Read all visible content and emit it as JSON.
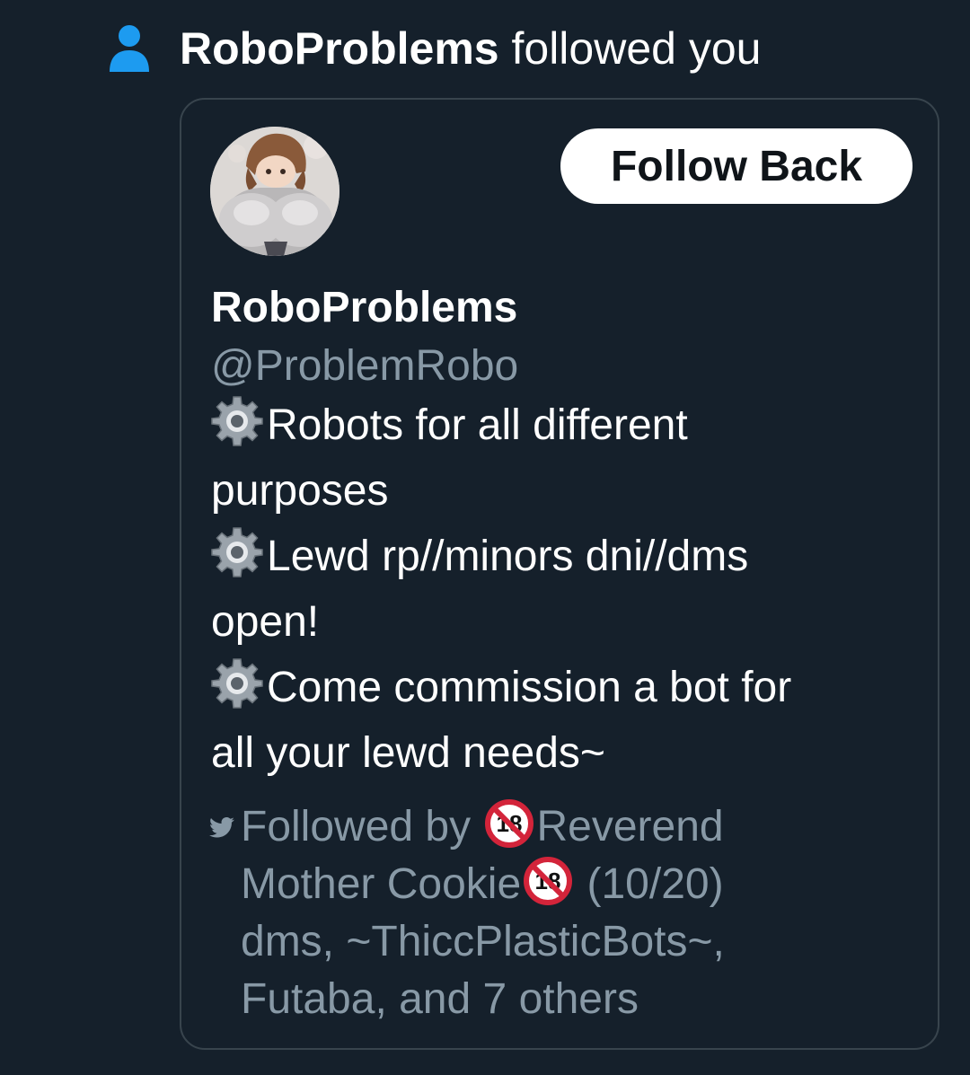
{
  "notification": {
    "icon": "person-icon",
    "user_name": "RoboProblems",
    "action_text": "followed you",
    "accent_color": "#1d9bf0"
  },
  "card": {
    "avatar": "avatar",
    "follow_back_label": "Follow Back",
    "display_name": "RoboProblems",
    "handle": "@ProblemRobo",
    "bio_lines": [
      {
        "icon": "gear-icon",
        "text": "Robots for all different"
      },
      {
        "icon": "",
        "text": "purposes"
      },
      {
        "icon": "gear-icon",
        "text": "Lewd rp//minors dni//dms"
      },
      {
        "icon": "",
        "text": "open!"
      },
      {
        "icon": "gear-icon",
        "text": "Come commission a bot for"
      },
      {
        "icon": "",
        "text": "all your lewd needs~"
      }
    ],
    "followed_by": {
      "icon": "bird-icon",
      "prefix": "Followed by ",
      "name1_emoji": "no-under-18-icon",
      "name1_part1": "Reverend",
      "name1_part2": "Mother Cookie",
      "name1_suffix": " (10/20)",
      "line3": "dms, ~ThiccPlasticBots~,",
      "line4": "Futaba, and 7 others"
    }
  },
  "colors": {
    "background": "#15202b",
    "border": "#38444d",
    "secondary_text": "#8899a6",
    "button_bg": "#ffffff",
    "button_text": "#0f1419"
  }
}
